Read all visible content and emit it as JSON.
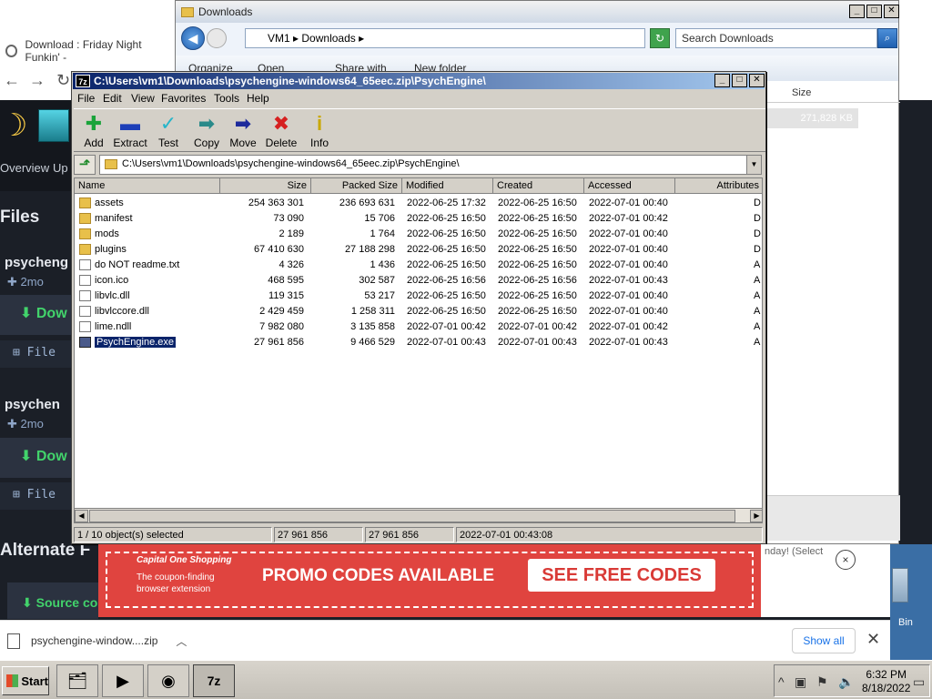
{
  "browser": {
    "tab_title": "Download : Friday Night Funkin' -",
    "nav_overview": "Overview",
    "nav_up": "Up",
    "files_heading": "Files",
    "package1_name": "psycheng",
    "package1_age": "2mo",
    "download_label": "Dow",
    "file_label": "File",
    "package2_name": "psychen",
    "package2_age": "2mo",
    "alternate_heading": "Alternate F",
    "source_label": "Source co"
  },
  "explorer": {
    "title": "Downloads",
    "path_vm": "VM1",
    "path_folder": "Downloads",
    "search_placeholder": "Search Downloads",
    "cmd_organize": "Organize",
    "cmd_open": "Open",
    "cmd_share": "Share with",
    "cmd_newfolder": "New folder",
    "col_size": "Size",
    "selected_size": "271,828 KB"
  },
  "sevenzip": {
    "title": "C:\\Users\\vm1\\Downloads\\psychengine-windows64_65eec.zip\\PsychEngine\\",
    "menu": [
      "File",
      "Edit",
      "View",
      "Favorites",
      "Tools",
      "Help"
    ],
    "toolbar": [
      {
        "label": "Add",
        "icon": "add-icon",
        "glyph": "✚",
        "color": "#1aa33a"
      },
      {
        "label": "Extract",
        "icon": "extract-icon",
        "glyph": "▬",
        "color": "#1d3fb8"
      },
      {
        "label": "Test",
        "icon": "test-icon",
        "glyph": "✓",
        "color": "#26b5c9"
      },
      {
        "label": "Copy",
        "icon": "copy-icon",
        "glyph": "➡",
        "color": "#2a8a8a"
      },
      {
        "label": "Move",
        "icon": "move-icon",
        "glyph": "➡",
        "color": "#1d2a9c"
      },
      {
        "label": "Delete",
        "icon": "delete-icon",
        "glyph": "✖",
        "color": "#d62020"
      },
      {
        "label": "Info",
        "icon": "info-icon",
        "glyph": "i",
        "color": "#c9a800"
      }
    ],
    "path": "C:\\Users\\vm1\\Downloads\\psychengine-windows64_65eec.zip\\PsychEngine\\",
    "columns": [
      "Name",
      "Size",
      "Packed Size",
      "Modified",
      "Created",
      "Accessed",
      "Attributes"
    ],
    "rows": [
      {
        "name": "assets",
        "type": "folder",
        "size": "254 363 301",
        "packed": "236 693 631",
        "modified": "2022-06-25 17:32",
        "created": "2022-06-25 16:50",
        "accessed": "2022-07-01 00:40",
        "attr": "D"
      },
      {
        "name": "manifest",
        "type": "folder",
        "size": "73 090",
        "packed": "15 706",
        "modified": "2022-06-25 16:50",
        "created": "2022-06-25 16:50",
        "accessed": "2022-07-01 00:42",
        "attr": "D"
      },
      {
        "name": "mods",
        "type": "folder",
        "size": "2 189",
        "packed": "1 764",
        "modified": "2022-06-25 16:50",
        "created": "2022-06-25 16:50",
        "accessed": "2022-07-01 00:40",
        "attr": "D"
      },
      {
        "name": "plugins",
        "type": "folder",
        "size": "67 410 630",
        "packed": "27 188 298",
        "modified": "2022-06-25 16:50",
        "created": "2022-06-25 16:50",
        "accessed": "2022-07-01 00:40",
        "attr": "D"
      },
      {
        "name": "do NOT readme.txt",
        "type": "file",
        "size": "4 326",
        "packed": "1 436",
        "modified": "2022-06-25 16:50",
        "created": "2022-06-25 16:50",
        "accessed": "2022-07-01 00:40",
        "attr": "A"
      },
      {
        "name": "icon.ico",
        "type": "file",
        "size": "468 595",
        "packed": "302 587",
        "modified": "2022-06-25 16:56",
        "created": "2022-06-25 16:56",
        "accessed": "2022-07-01 00:43",
        "attr": "A"
      },
      {
        "name": "libvlc.dll",
        "type": "dll",
        "size": "119 315",
        "packed": "53 217",
        "modified": "2022-06-25 16:50",
        "created": "2022-06-25 16:50",
        "accessed": "2022-07-01 00:40",
        "attr": "A"
      },
      {
        "name": "libvlccore.dll",
        "type": "dll",
        "size": "2 429 459",
        "packed": "1 258 311",
        "modified": "2022-06-25 16:50",
        "created": "2022-06-25 16:50",
        "accessed": "2022-07-01 00:40",
        "attr": "A"
      },
      {
        "name": "lime.ndll",
        "type": "file",
        "size": "7 982 080",
        "packed": "3 135 858",
        "modified": "2022-07-01 00:42",
        "created": "2022-07-01 00:42",
        "accessed": "2022-07-01 00:42",
        "attr": "A"
      },
      {
        "name": "PsychEngine.exe",
        "type": "exe",
        "size": "27 961 856",
        "packed": "9 466 529",
        "modified": "2022-07-01 00:43",
        "created": "2022-07-01 00:43",
        "accessed": "2022-07-01 00:43",
        "attr": "A",
        "selected": true
      }
    ],
    "status": {
      "selection": "1 / 10 object(s) selected",
      "size": "27 961 856",
      "packed": "27 961 856",
      "modified": "2022-07-01 00:43:08"
    }
  },
  "ad": {
    "brand": "Capital One Shopping",
    "sub": "The coupon-finding browser extension",
    "headline": "PROMO CODES AVAILABLE",
    "cta": "SEE FREE CODES",
    "close": "×"
  },
  "right_strip_text": "nday! (Select",
  "desktop": {
    "recycle_bin_label": "Bin"
  },
  "download_bar": {
    "file_name": "psychengine-window....zip",
    "show_all": "Show all",
    "close": "✕"
  },
  "taskbar": {
    "start_label": "Start",
    "time": "6:32 PM",
    "date": "8/18/2022"
  }
}
